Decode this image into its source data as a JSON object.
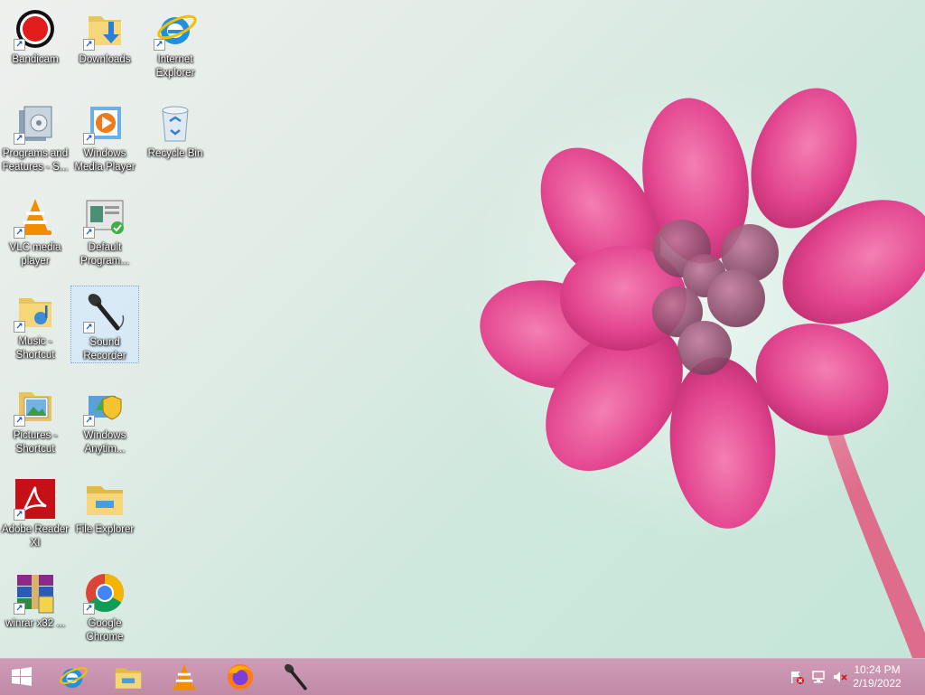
{
  "desktop": {
    "icons": [
      {
        "label": "Bandicam",
        "icon": "bandicam-icon"
      },
      {
        "label": "Downloads",
        "icon": "downloads-folder-icon"
      },
      {
        "label": "Internet Explorer",
        "icon": "internet-explorer-icon"
      },
      {
        "label": "Programs and Features - S...",
        "icon": "programs-features-icon"
      },
      {
        "label": "Windows Media Player",
        "icon": "media-player-icon"
      },
      {
        "label": "Recycle Bin",
        "icon": "recycle-bin-icon"
      },
      {
        "label": "VLC media player",
        "icon": "vlc-icon"
      },
      {
        "label": "Default Program...",
        "icon": "default-programs-icon"
      },
      {
        "label": "Music - Shortcut",
        "icon": "music-folder-icon"
      },
      {
        "label": "Sound Recorder",
        "icon": "microphone-icon",
        "selected": true
      },
      {
        "label": "Pictures - Shortcut",
        "icon": "pictures-folder-icon"
      },
      {
        "label": "Windows Anytim...",
        "icon": "windows-anytime-icon"
      },
      {
        "label": "Adobe Reader XI",
        "icon": "adobe-reader-icon"
      },
      {
        "label": "File Explorer",
        "icon": "file-explorer-icon"
      },
      {
        "label": "winrar x32 ...",
        "icon": "winrar-icon"
      },
      {
        "label": "Google Chrome",
        "icon": "chrome-icon"
      }
    ]
  },
  "taskbar": {
    "start": "windows-logo-icon",
    "pinned": [
      "internet-explorer-icon",
      "file-explorer-icon",
      "vlc-icon",
      "firefox-icon",
      "microphone-icon"
    ],
    "tray": [
      "action-center-flag-icon",
      "network-icon",
      "speaker-muted-icon"
    ],
    "clock": {
      "time": "10:24 PM",
      "date": "2/19/2022"
    }
  },
  "colors": {
    "taskbar": "#c792ae",
    "flower": "#e8408c",
    "selection": "#cce8ff"
  }
}
